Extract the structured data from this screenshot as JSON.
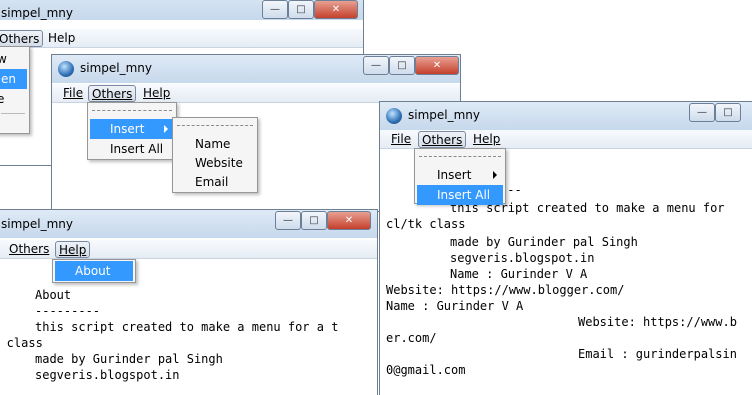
{
  "win1": {
    "title": "simpel_mny",
    "menu": {
      "others": "Others",
      "help": "Help"
    },
    "popup": {
      "item1": "w",
      "item2": "en",
      "item3": "e"
    }
  },
  "win2": {
    "title": "simpel_mny",
    "menu": {
      "file": "File",
      "others": "Others",
      "help": "Help"
    },
    "others_menu": {
      "insert": "Insert",
      "insert_all": "Insert All"
    },
    "insert_submenu": {
      "name": "Name",
      "website": "Website",
      "email": "Email"
    }
  },
  "win3": {
    "title": "simpel_mny",
    "menu": {
      "others": "Others",
      "help": "Help"
    },
    "help_menu": {
      "about": "About"
    },
    "body_lines": [
      "About",
      "---------",
      "this script created to make a menu for a t",
      "tk class",
      "made by Gurinder pal Singh",
      "segveris.blogspot.in"
    ]
  },
  "win4": {
    "title": "simpel_mny",
    "menu": {
      "file": "File",
      "others": "Others",
      "help": "Help"
    },
    "others_menu": {
      "insert": "Insert",
      "insert_all": "Insert All"
    },
    "body_lines": [
      "---",
      "this script created to make a menu for",
      "cl/tk class",
      "made by Gurinder pal Singh",
      "segveris.blogspot.in",
      "Name : Gurinder V A",
      "Website: https://www.blogger.com/",
      "Name : Gurinder V A",
      "Website: https://www.b",
      "er.com/",
      "Email : gurinderpalsin",
      "0@gmail.com"
    ]
  },
  "colors": {
    "highlight": "#3399ff",
    "titlebar": "#c6d8ec",
    "close": "#c4402c"
  }
}
